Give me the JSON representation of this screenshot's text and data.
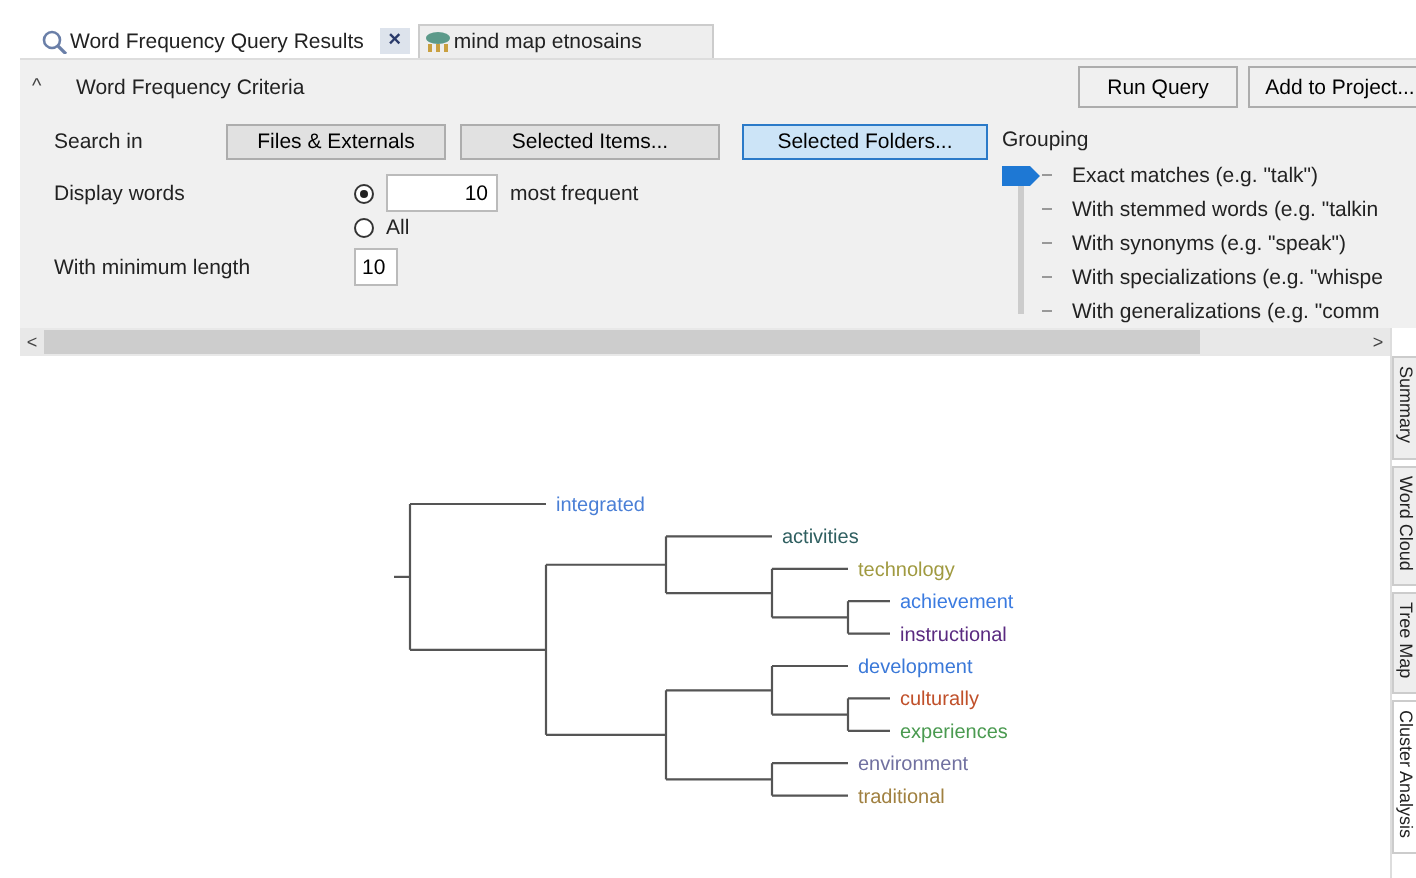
{
  "tabs": [
    {
      "label": "Word Frequency Query Results",
      "selected": true,
      "close": "×"
    },
    {
      "label": "mind map etnosains",
      "selected": false
    }
  ],
  "criteria": {
    "collapse": "^",
    "title": "Word Frequency Criteria",
    "actions": [
      "Run Query",
      "Add to Project..."
    ],
    "search_in": {
      "label": "Search in",
      "buttons": [
        {
          "label": "Files & Externals",
          "selected": false
        },
        {
          "label": "Selected Items...",
          "selected": false
        },
        {
          "label": "Selected Folders...",
          "selected": true
        }
      ]
    },
    "display_words": {
      "label": "Display words",
      "options": [
        {
          "kind": "count",
          "selected": true,
          "value": "10",
          "suffix": "most frequent"
        },
        {
          "kind": "all",
          "selected": false,
          "label": "All"
        }
      ]
    },
    "min_length": {
      "label": "With minimum length",
      "value": "10"
    },
    "grouping": {
      "label": "Grouping",
      "options": [
        {
          "label": "Exact matches (e.g. \"talk\")",
          "selected": true
        },
        {
          "label": "With stemmed words (e.g. \"talkin",
          "selected": false
        },
        {
          "label": "With synonyms (e.g. \"speak\")",
          "selected": false
        },
        {
          "label": "With specializations (e.g. \"whispe",
          "selected": false
        },
        {
          "label": "With generalizations (e.g. \"comm",
          "selected": false
        }
      ]
    }
  },
  "scrollbar": {
    "left": "<",
    "right": ">"
  },
  "dendrogram": {
    "children": [
      {
        "label": "integrated",
        "color": "#4a7fd6"
      },
      {
        "children": [
          {
            "children": [
              {
                "label": "activities",
                "color": "#2f5f60"
              },
              {
                "children": [
                  {
                    "label": "technology",
                    "color": "#a09a40"
                  },
                  {
                    "children": [
                      {
                        "label": "achievement",
                        "color": "#3b7be0"
                      },
                      {
                        "label": "instructional",
                        "color": "#5a2a80"
                      }
                    ]
                  }
                ]
              }
            ]
          },
          {
            "children": [
              {
                "children": [
                  {
                    "label": "development",
                    "color": "#3a78d8"
                  },
                  {
                    "children": [
                      {
                        "label": "culturally",
                        "color": "#c0502a"
                      },
                      {
                        "label": "experiences",
                        "color": "#4a9a50"
                      }
                    ]
                  }
                ]
              },
              {
                "children": [
                  {
                    "label": "environment",
                    "color": "#7070a0"
                  },
                  {
                    "label": "traditional",
                    "color": "#a08040"
                  }
                ]
              }
            ]
          }
        ]
      }
    ]
  },
  "side_tabs": [
    {
      "label": "Summary",
      "selected": false
    },
    {
      "label": "Word Cloud",
      "selected": false
    },
    {
      "label": "Tree Map",
      "selected": false
    },
    {
      "label": "Cluster Analysis",
      "selected": true
    }
  ]
}
